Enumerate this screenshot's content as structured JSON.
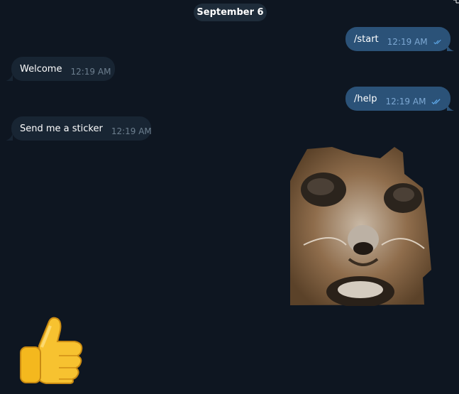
{
  "chat": {
    "date_separator": "September 6",
    "messages": [
      {
        "direction": "out",
        "text": "/start",
        "time": "12:19 AM",
        "status": "read"
      },
      {
        "direction": "in",
        "text": "Welcome",
        "time": "12:19 AM"
      },
      {
        "direction": "out",
        "text": "/help",
        "time": "12:19 AM",
        "status": "read"
      },
      {
        "direction": "in",
        "text": "Send me a sticker",
        "time": "12:19 AM"
      },
      {
        "direction": "out",
        "type": "sticker",
        "sticker": "surprised-cat"
      },
      {
        "direction": "in",
        "type": "sticker",
        "sticker": "thumbs-up"
      }
    ]
  },
  "colors": {
    "background": "#0e1621",
    "outgoing_bubble": "#2b5278",
    "incoming_bubble": "#182533",
    "read_ticks": "#5fa8e8"
  }
}
